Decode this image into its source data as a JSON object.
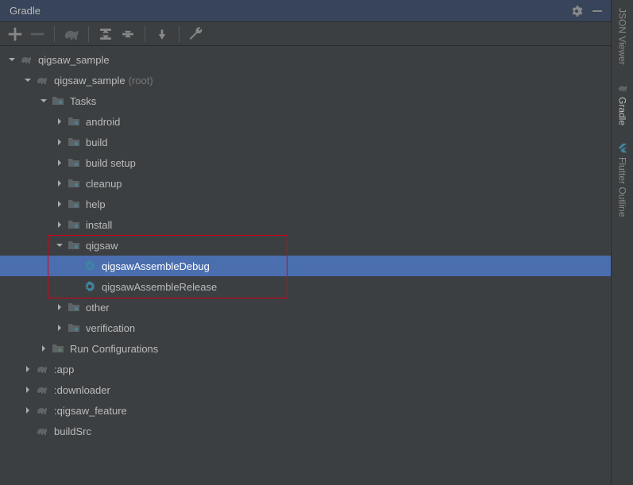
{
  "panel": {
    "title": "Gradle"
  },
  "tree": {
    "nodes": [
      {
        "id": "root",
        "label": "qigsaw_sample",
        "depth": 0,
        "icon": "elephant",
        "expand": "down"
      },
      {
        "id": "proj",
        "label": "qigsaw_sample",
        "suffix": "(root)",
        "depth": 1,
        "icon": "elephant",
        "expand": "down"
      },
      {
        "id": "tasks",
        "label": "Tasks",
        "depth": 2,
        "icon": "folder",
        "expand": "down"
      },
      {
        "id": "android",
        "label": "android",
        "depth": 3,
        "icon": "folder",
        "expand": "right"
      },
      {
        "id": "build",
        "label": "build",
        "depth": 3,
        "icon": "folder",
        "expand": "right"
      },
      {
        "id": "buildsetup",
        "label": "build setup",
        "depth": 3,
        "icon": "folder",
        "expand": "right"
      },
      {
        "id": "cleanup",
        "label": "cleanup",
        "depth": 3,
        "icon": "folder",
        "expand": "right"
      },
      {
        "id": "help",
        "label": "help",
        "depth": 3,
        "icon": "folder",
        "expand": "right"
      },
      {
        "id": "install",
        "label": "install",
        "depth": 3,
        "icon": "folder",
        "expand": "right"
      },
      {
        "id": "qigsaw",
        "label": "qigsaw",
        "depth": 3,
        "icon": "folder",
        "expand": "down"
      },
      {
        "id": "task-debug",
        "label": "qigsawAssembleDebug",
        "depth": 4,
        "icon": "task",
        "expand": "none",
        "selected": true
      },
      {
        "id": "task-release",
        "label": "qigsawAssembleRelease",
        "depth": 4,
        "icon": "task",
        "expand": "none"
      },
      {
        "id": "other",
        "label": "other",
        "depth": 3,
        "icon": "folder",
        "expand": "right"
      },
      {
        "id": "verification",
        "label": "verification",
        "depth": 3,
        "icon": "folder",
        "expand": "right"
      },
      {
        "id": "runconfig",
        "label": "Run Configurations",
        "depth": 2,
        "icon": "folder-run",
        "expand": "right"
      },
      {
        "id": "app",
        "label": ":app",
        "depth": 1,
        "icon": "elephant",
        "expand": "right"
      },
      {
        "id": "downloader",
        "label": ":downloader",
        "depth": 1,
        "icon": "elephant",
        "expand": "right"
      },
      {
        "id": "feature",
        "label": ":qigsaw_feature",
        "depth": 1,
        "icon": "elephant",
        "expand": "right"
      },
      {
        "id": "buildsrc",
        "label": "buildSrc",
        "depth": 1,
        "icon": "elephant",
        "expand": "none"
      }
    ]
  },
  "sideTabs": {
    "json": "JSON Viewer",
    "gradle": "Gradle",
    "flutter": "Flutter Outline"
  }
}
